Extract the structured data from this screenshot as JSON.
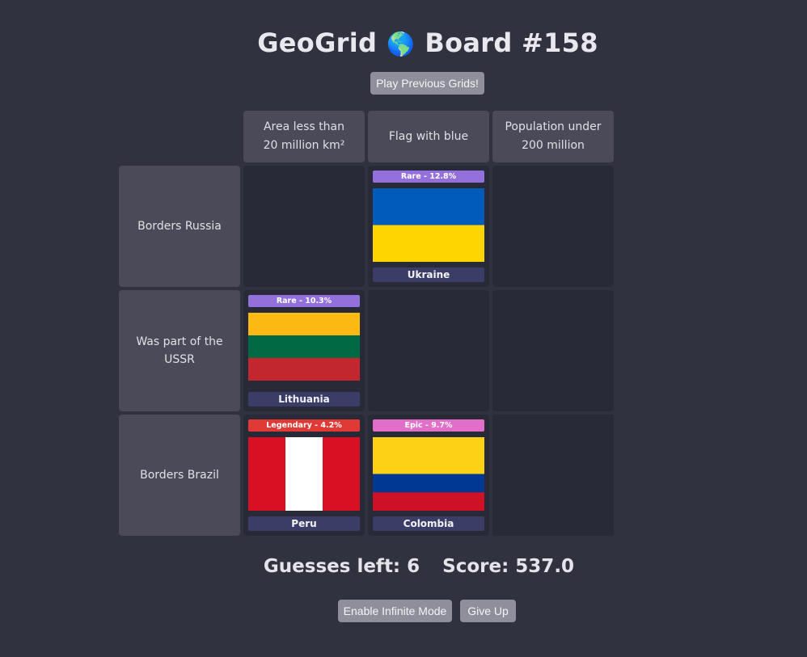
{
  "header": {
    "title_left": "GeoGrid",
    "globe": "🌎",
    "title_right": "Board #158",
    "prev_button": "Play Previous Grids!"
  },
  "columns": [
    "Area less than 20 million km²",
    "Flag with blue",
    "Population under 200 million"
  ],
  "rows": [
    "Borders Russia",
    "Was part of the USSR",
    "Borders Brazil"
  ],
  "cells": {
    "r0c1": {
      "rarity": "Rare - 12.8%",
      "rarity_color": "#9370db",
      "country": "Ukraine"
    },
    "r1c0": {
      "rarity": "Rare - 10.3%",
      "rarity_color": "#9370db",
      "country": "Lithuania"
    },
    "r2c0": {
      "rarity": "Legendary - 4.2%",
      "rarity_color": "#e03a36",
      "country": "Peru"
    },
    "r2c1": {
      "rarity": "Epic - 9.7%",
      "rarity_color": "#e16fc9",
      "country": "Colombia"
    }
  },
  "status": {
    "guesses": "Guesses left: 6",
    "score": "Score: 537.0"
  },
  "actions": {
    "infinite": "Enable Infinite Mode",
    "give_up": "Give Up"
  },
  "colors": {
    "background": "#31323f",
    "header_cell": "#4a4a58",
    "empty_cell": "#292a37",
    "name_bar": "#3b3d67"
  }
}
